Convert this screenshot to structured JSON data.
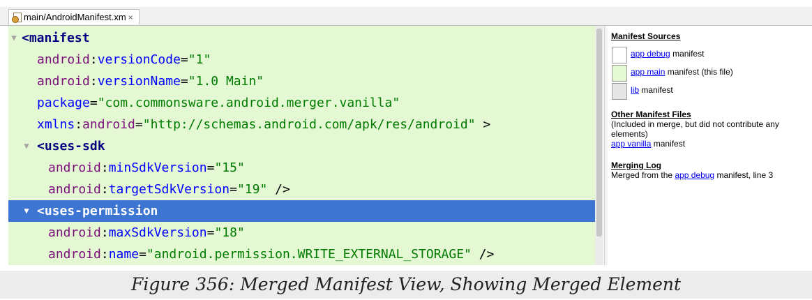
{
  "tab": {
    "icon": "manifest-file-icon",
    "label": "main/AndroidManifest.xm",
    "close": "×"
  },
  "colors": {
    "editor_bg": "#e4f8d4",
    "selection": "#3d75d3",
    "link": "#0000ee"
  },
  "code": {
    "l1": {
      "tag": "<manifest"
    },
    "l2": {
      "ns": "android",
      "colon": ":",
      "attr": "versionCode",
      "eq": "=",
      "val": "\"1\""
    },
    "l3": {
      "ns": "android",
      "colon": ":",
      "attr": "versionName",
      "eq": "=",
      "val": "\"1.0 Main\""
    },
    "l4": {
      "attr": "package",
      "eq": "=",
      "val": "\"com.commonsware.android.merger.vanilla\""
    },
    "l5": {
      "attr": "xmlns",
      "colon": ":",
      "ns": "android",
      "eq": "=",
      "val": "\"http://schemas.android.com/apk/res/android\"",
      "close": " >"
    },
    "l6": {
      "tag": "<uses-sdk"
    },
    "l7": {
      "ns": "android",
      "colon": ":",
      "attr": "minSdkVersion",
      "eq": "=",
      "val": "\"15\""
    },
    "l8": {
      "ns": "android",
      "colon": ":",
      "attr": "targetSdkVersion",
      "eq": "=",
      "val": "\"19\"",
      "close": " />"
    },
    "l9": {
      "tag": "<uses-permission"
    },
    "l10": {
      "ns": "android",
      "colon": ":",
      "attr": "maxSdkVersion",
      "eq": "=",
      "val": "\"18\""
    },
    "l11": {
      "ns": "android",
      "colon": ":",
      "attr": "name",
      "eq": "=",
      "val": "\"android.permission.WRITE_EXTERNAL_STORAGE\"",
      "close": " />"
    }
  },
  "side": {
    "sources_title": "Manifest Sources",
    "sources": [
      {
        "link": "app debug",
        "rest": " manifest",
        "color": "#ffffff"
      },
      {
        "link": "app main",
        "rest": " manifest (this file)",
        "color": "#e4f8d4"
      },
      {
        "link": "lib",
        "rest": " manifest",
        "color": "#e6e6e6"
      }
    ],
    "other_title": "Other Manifest Files",
    "other_desc": "(Included in merge, but did not contribute any elements)",
    "other_link": "app vanilla",
    "other_rest": " manifest",
    "log_title": "Merging Log",
    "log_prefix": "Merged from the ",
    "log_link": "app debug",
    "log_suffix": " manifest, line 3"
  },
  "caption": "Figure 356: Merged Manifest View, Showing Merged Element"
}
